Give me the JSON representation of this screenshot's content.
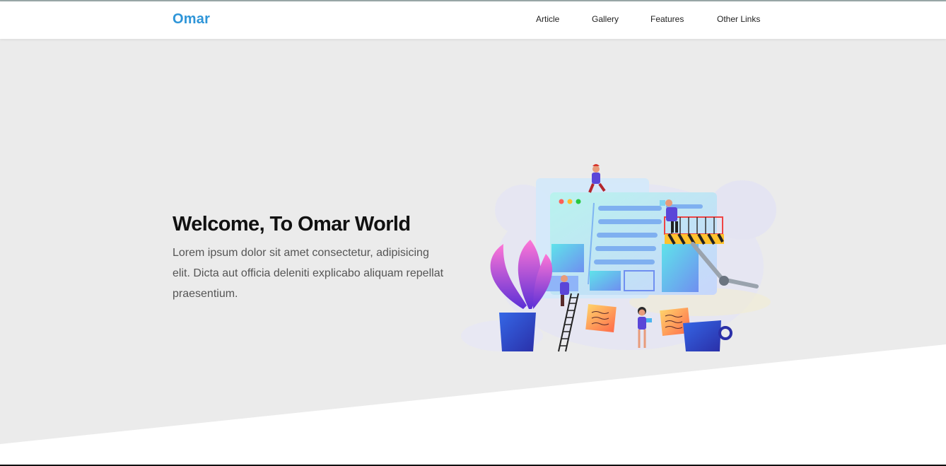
{
  "brand": {
    "name": "Omar",
    "color": "#2e95d8"
  },
  "nav": {
    "items": [
      {
        "label": "Article"
      },
      {
        "label": "Gallery"
      },
      {
        "label": "Features"
      },
      {
        "label": "Other Links"
      }
    ]
  },
  "hero": {
    "title": "Welcome, To Omar World",
    "description": "Lorem ipsum dolor sit amet consectetur, adipisicing elit. Dicta aut officia deleniti explicabo aliquam repellat praesentium.",
    "background_color": "#ebebeb",
    "scroll_icon": "double-chevron-down-icon"
  },
  "illustration": {
    "icon": "website-construction-illustration"
  }
}
